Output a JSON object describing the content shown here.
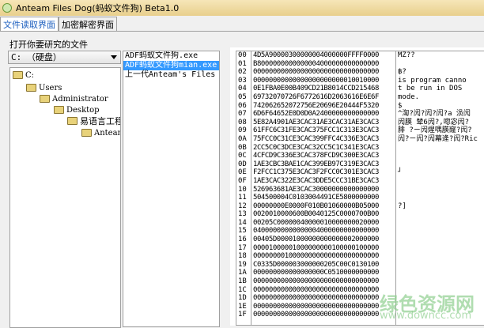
{
  "window": {
    "title": "Anteam Files Dog(蚂蚁文件狗) Beta1.0"
  },
  "tabs": [
    {
      "label": "文件读取界面"
    },
    {
      "label": "加密解密界面"
    }
  ],
  "left": {
    "group_label": "打开你要研究的文件",
    "drive": "C: （硬盘）",
    "tree": [
      "C:",
      "Users",
      "Administrator",
      "Desktop",
      "易语言工程",
      "Anteam"
    ],
    "files": [
      "ADF蚂蚁文件狗.exe",
      "ADF蚂蚁文件狗mian.exe",
      "上一代Anteam's Files C"
    ]
  },
  "hexview": {
    "offsets": [
      "00",
      "01",
      "02",
      "03",
      "04",
      "05",
      "06",
      "07",
      "08",
      "09",
      "0A",
      "0B",
      "0C",
      "0D",
      "0E",
      "0F",
      "10",
      "11",
      "12",
      "13",
      "14",
      "15",
      "16",
      "17",
      "18",
      "19",
      "1A",
      "1B",
      "1C",
      "1D",
      "1E",
      "1F"
    ],
    "hex": [
      "4D5A90000300000004000000FFFF0000",
      "B8000000000000004000000000000000",
      "00000000000000000000000000000000",
      "00000000000000000000000010010000",
      "0E1FBA0E00B409CD21B8014CCD215468",
      "69732070726F6772616D2063616E6E6F",
      "742062652072756E20696E20444F5320",
      "6D6F64652E0D0D0A2400000000000000",
      "5E82A4901AE3CAC31AE3CAC31AE3CAC3",
      "61FFC6C31FE3CAC375FCC1C313E3CAC3",
      "75FCC0C31CE3CAC399FFC4C336E3CAC3",
      "2CC5C0C3DCE3CAC32CC5C1C341E3CAC3",
      "4CFCD9C336E3CAC378FCD9C300E3CAC3",
      "1AE3CBC3BAE1CAC399EB97C319E3CAC3",
      "F2FCC1C375E3CAC3F2FCC0C301E3CAC3",
      "1AE3CAC322E3CAC3DDE5CCC31BE3CAC3",
      "526963681AE3CAC30000000000000000",
      "504500004C0103004491CE5800000000",
      "00000000E0000F010B01060000B05000",
      "0020010000600B0040125C0000700B00",
      "00205C00000040000010000000020000",
      "04000000000000004000000000000000",
      "00405D00001000000000000002000000",
      "00001000001000000000100000100000",
      "00000000100000000000000000000000",
      "C0335D000003000000205C00C0130100",
      "000000000000000000C0510000000000",
      "00000000000000000000000000000000",
      "00000000000000000000000000000000",
      "00000000000000000000000000000000",
      "00000000000000000000000000000000",
      "00000000000000000000000000000000"
    ],
    "ascii": [
      "MZ??",
      "",
      "฿?",
      "is program canno",
      "t be run in DOS",
      "mode.",
      "$",
      "^渹?闶?闶?闶?a  涢闶",
      "闶朠  辇6闶?,唿宓闶?",
      "腓  ?ㄧ闶煋喁朠窿?闶?",
      "闶?ㄧ闶?闶幕逄?闶?Ric",
      "",
      "",
      "",
      "┘",
      "",
      "",
      "",
      "?]",
      "",
      "",
      "",
      "",
      "",
      "",
      "",
      "",
      "",
      "",
      "",
      "",
      ""
    ]
  },
  "watermark": {
    "cn": "绿色资源网",
    "url": "www.downcc.com"
  }
}
